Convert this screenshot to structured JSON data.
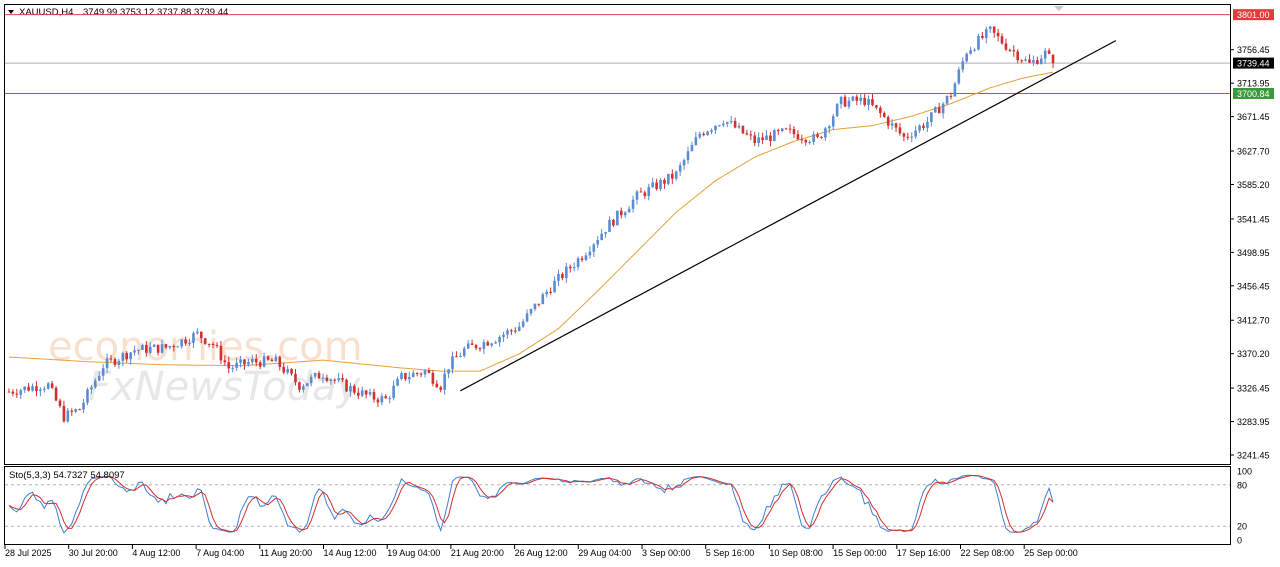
{
  "header": {
    "symbol": "XAUUSD,H4",
    "ohlc": "3749.99 3753.12 3737.88 3739.44"
  },
  "watermark": {
    "brand1": "economies.com",
    "brand2": "FxNewsToday"
  },
  "stoch_label": "Sto(5,3,3) 54.7327 54.8097",
  "colors": {
    "up": "#5b8bd3",
    "down": "#d32f2f",
    "ma": "#e6a13a",
    "trend": "#000000",
    "resistance": "#e23b3b",
    "support": "#3a9a3a",
    "price_line": "#b0b0b0",
    "stoch_main": "#3f7fd8",
    "stoch_signal": "#d32f2f"
  },
  "chart_data": {
    "type": "candlestick",
    "ylim": [
      3230,
      3812
    ],
    "y_ticks": [
      "3756.45",
      "3713.95",
      "3671.45",
      "3627.70",
      "3585.20",
      "3541.45",
      "3498.95",
      "3456.45",
      "3412.70",
      "3370.20",
      "3326.45",
      "3283.95",
      "3241.45"
    ],
    "x_ticks": [
      "28 Jul 2025",
      "30 Jul 20:00",
      "4 Aug 12:00",
      "7 Aug 04:00",
      "11 Aug 20:00",
      "14 Aug 12:00",
      "19 Aug 04:00",
      "21 Aug 20:00",
      "26 Aug 12:00",
      "29 Aug 04:00",
      "3 Sep 00:00",
      "5 Sep 16:00",
      "10 Sep 08:00",
      "15 Sep 00:00",
      "17 Sep 16:00",
      "22 Sep 08:00",
      "25 Sep 00:00"
    ],
    "levels": {
      "resistance": {
        "value": 3801.0,
        "label": "3801.00"
      },
      "current": {
        "value": 3739.44,
        "label": "3739.44"
      },
      "support": {
        "value": 3700.84,
        "label": "3700.84"
      }
    },
    "close_keypoints": [
      [
        0,
        3322
      ],
      [
        8,
        3330
      ],
      [
        10,
        3330
      ],
      [
        14,
        3290
      ],
      [
        18,
        3300
      ],
      [
        24,
        3355
      ],
      [
        32,
        3375
      ],
      [
        40,
        3378
      ],
      [
        48,
        3395
      ],
      [
        52,
        3382
      ],
      [
        56,
        3352
      ],
      [
        62,
        3360
      ],
      [
        68,
        3360
      ],
      [
        74,
        3330
      ],
      [
        80,
        3345
      ],
      [
        86,
        3328
      ],
      [
        92,
        3315
      ],
      [
        96,
        3312
      ],
      [
        100,
        3340
      ],
      [
        106,
        3348
      ],
      [
        110,
        3330
      ],
      [
        112,
        3355
      ],
      [
        116,
        3375
      ],
      [
        124,
        3390
      ],
      [
        130,
        3405
      ],
      [
        138,
        3455
      ],
      [
        146,
        3495
      ],
      [
        152,
        3530
      ],
      [
        160,
        3570
      ],
      [
        170,
        3598
      ],
      [
        176,
        3650
      ],
      [
        182,
        3668
      ],
      [
        190,
        3640
      ],
      [
        198,
        3652
      ],
      [
        206,
        3642
      ],
      [
        212,
        3690
      ],
      [
        218,
        3692
      ],
      [
        222,
        3675
      ],
      [
        228,
        3645
      ],
      [
        234,
        3665
      ],
      [
        240,
        3700
      ],
      [
        244,
        3755
      ],
      [
        250,
        3780
      ],
      [
        254,
        3762
      ],
      [
        260,
        3738
      ],
      [
        264,
        3752
      ],
      [
        266,
        3740
      ]
    ],
    "ma_keypoints": [
      [
        0,
        3366
      ],
      [
        20,
        3360
      ],
      [
        40,
        3356
      ],
      [
        60,
        3355
      ],
      [
        80,
        3362
      ],
      [
        100,
        3352
      ],
      [
        110,
        3348
      ],
      [
        120,
        3348
      ],
      [
        130,
        3370
      ],
      [
        140,
        3402
      ],
      [
        150,
        3450
      ],
      [
        160,
        3500
      ],
      [
        170,
        3550
      ],
      [
        180,
        3590
      ],
      [
        190,
        3620
      ],
      [
        200,
        3640
      ],
      [
        210,
        3655
      ],
      [
        220,
        3660
      ],
      [
        230,
        3672
      ],
      [
        240,
        3688
      ],
      [
        250,
        3708
      ],
      [
        258,
        3720
      ],
      [
        266,
        3728
      ]
    ],
    "trendline": [
      [
        115,
        3323
      ],
      [
        282,
        3768
      ]
    ],
    "stochastic": {
      "name": "Sto(5,3,3)",
      "main": 54.7327,
      "signal": 54.8097,
      "ylim": [
        0,
        100
      ],
      "levels": [
        80,
        20
      ],
      "axis_labels": [
        "100",
        "80",
        "20",
        "0"
      ]
    }
  }
}
